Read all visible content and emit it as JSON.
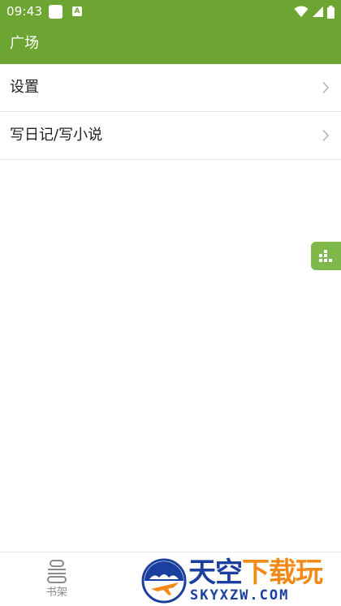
{
  "status_bar": {
    "time": "09:43",
    "notification_letter": "A",
    "icons": [
      "notification-square-icon",
      "notification-a-icon",
      "wifi-icon",
      "signal-icon",
      "battery-icon"
    ]
  },
  "app_bar": {
    "title": "广场"
  },
  "menu": {
    "items": [
      {
        "label": "设置",
        "icon": "chevron-right-icon"
      },
      {
        "label": "写日记/写小说",
        "icon": "chevron-right-icon"
      }
    ]
  },
  "floating_button": {
    "icon": "equalizer-grid-icon"
  },
  "bottom_nav": {
    "tabs": [
      {
        "label": "书架",
        "icon": "bookshelf-stack-icon"
      }
    ]
  },
  "watermark": {
    "text_blue": "天空",
    "text_orange": "下载玩",
    "url": "SKYXZW.COM"
  },
  "colors": {
    "primary": "#6da533",
    "floating_button": "#7eb84a",
    "watermark_blue": "#1a3f9e",
    "watermark_orange": "#f28a1a"
  }
}
